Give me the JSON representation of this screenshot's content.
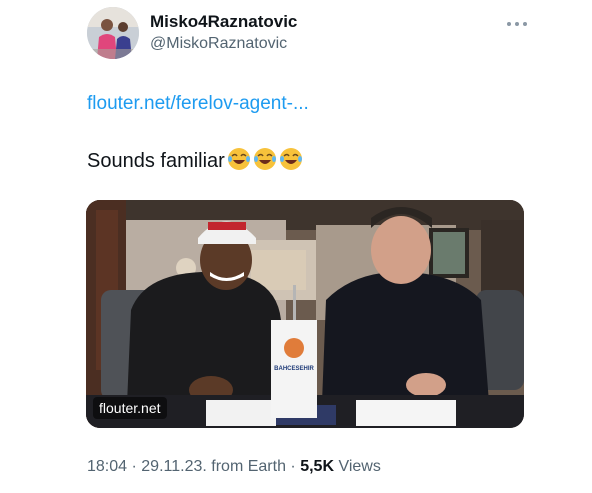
{
  "author": {
    "display_name": "Misko4Raznatovic",
    "handle": "@MiskoRaznatovic"
  },
  "tweet": {
    "link_text": "flouter.net/ferelov-agent-...",
    "text": "Sounds familiar",
    "emojis": [
      "😂",
      "😂",
      "😂"
    ],
    "media_domain": "flouter.net",
    "media_desk_flag_text": "BAHCESEHIR",
    "time": "18:04",
    "date": "29.11.23.",
    "source": "from Earth",
    "views_count": "5,5K",
    "views_label": "Views",
    "separator": "·"
  },
  "colors": {
    "link": "#1d9bf0",
    "secondary_text": "#536471",
    "primary_text": "#0f1419"
  },
  "icons": {
    "more": "more-horizontal-icon",
    "avatar": "avatar-photo"
  }
}
